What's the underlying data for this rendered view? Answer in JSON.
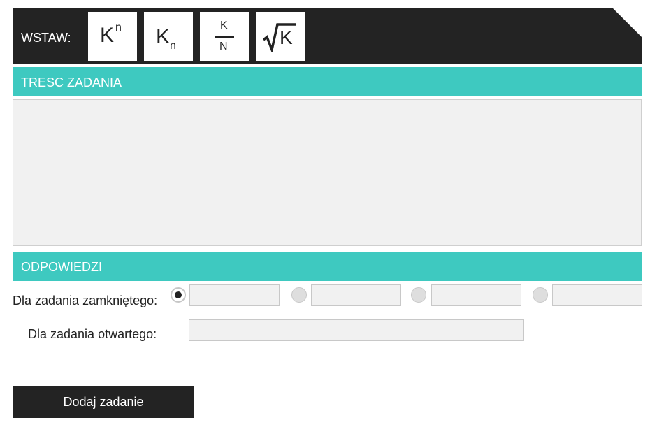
{
  "toolbar": {
    "label": "WSTAW:",
    "superscript": {
      "base": "K",
      "exp": "n"
    },
    "subscript": {
      "base": "K",
      "sub": "n"
    },
    "fraction": {
      "num": "K",
      "den": "N"
    },
    "sqrt": {
      "radicand": "K"
    }
  },
  "task_section": {
    "title": "TRESC ZADANIA",
    "value": ""
  },
  "answers_section": {
    "title": "ODPOWIEDZI",
    "closed_label": "Dla zadania zamkniętego:",
    "open_label": "Dla zadania otwartego:",
    "closed_options": [
      {
        "selected": true,
        "value": ""
      },
      {
        "selected": false,
        "value": ""
      },
      {
        "selected": false,
        "value": ""
      },
      {
        "selected": false,
        "value": ""
      }
    ],
    "open_value": ""
  },
  "submit_label": "Dodaj zadanie",
  "colors": {
    "dark": "#232323",
    "accent": "#3ec9c0",
    "field_bg": "#f1f1f1"
  }
}
